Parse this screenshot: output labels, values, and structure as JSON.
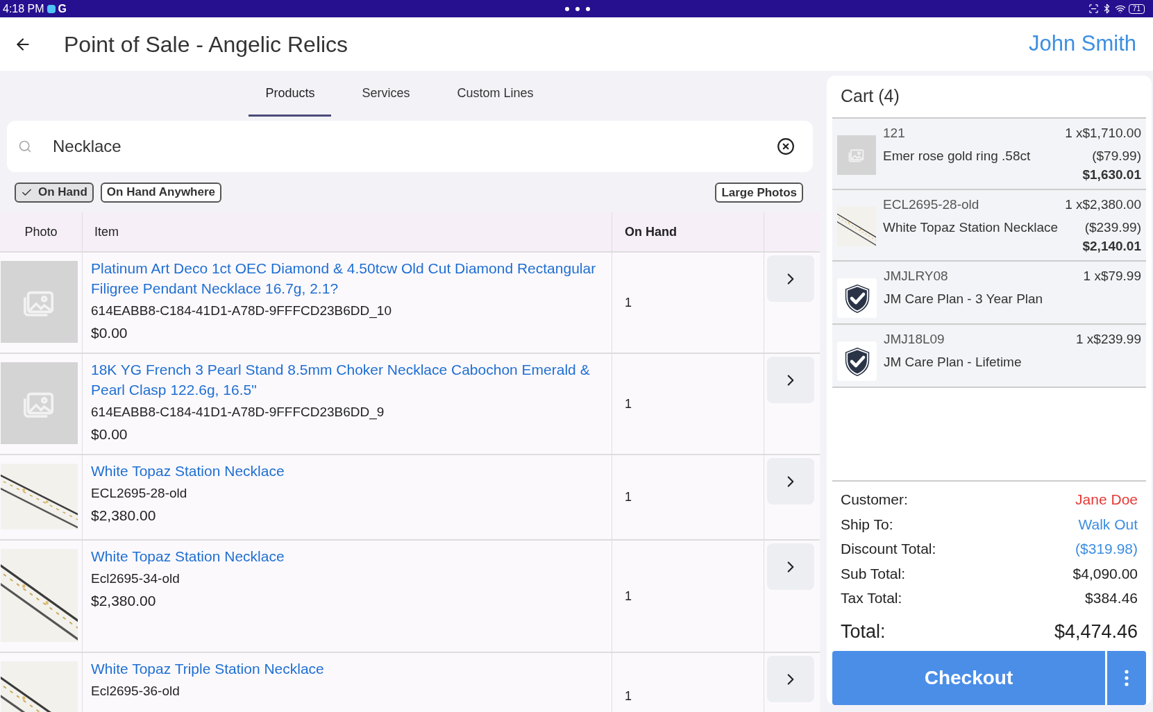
{
  "status_bar": {
    "time": "4:18 PM",
    "app_letter": "G",
    "battery": "71"
  },
  "header": {
    "title": "Point of Sale - Angelic Relics",
    "user": "John Smith"
  },
  "tabs": [
    {
      "label": "Products",
      "selected": true
    },
    {
      "label": "Services",
      "selected": false
    },
    {
      "label": "Custom Lines",
      "selected": false
    }
  ],
  "search": {
    "value": "Necklace"
  },
  "filters": [
    {
      "label": "On Hand",
      "checked": true
    },
    {
      "label": "On Hand Anywhere",
      "checked": false
    }
  ],
  "large_photos_button": "Large Photos",
  "table": {
    "columns": [
      "Photo",
      "Item",
      "On Hand"
    ],
    "rows": [
      {
        "kind": "placeholder",
        "name": "Platinum Art Deco 1ct OEC Diamond & 4.50tcw Old Cut Diamond Rectangular Filigree Pendant Necklace 16.7g, 2.1?",
        "sku": "614EABB8-C184-41D1-A78D-9FFFCD23B6DD_10",
        "price": "$0.00",
        "on_hand": "1"
      },
      {
        "kind": "placeholder",
        "name": "18K YG French 3 Pearl Stand 8.5mm Choker Necklace Cabochon Emerald & Pearl Clasp 122.6g, 16.5\"",
        "sku": "614EABB8-C184-41D1-A78D-9FFFCD23B6DD_9",
        "price": "$0.00",
        "on_hand": "1"
      },
      {
        "kind": "necklace",
        "name": "White Topaz Station Necklace",
        "sku": "ECL2695-28-old",
        "price": "$2,380.00",
        "on_hand": "1"
      },
      {
        "kind": "necklace",
        "name": "White Topaz Station Necklace",
        "sku": "Ecl2695-34-old",
        "price": "$2,380.00",
        "on_hand": "1"
      },
      {
        "kind": "necklace",
        "name": "White Topaz Triple Station Necklace",
        "sku": "Ecl2695-36-old",
        "on_hand": "1"
      }
    ]
  },
  "cart": {
    "title": "Cart (4)",
    "items": [
      {
        "kind": "placeholder",
        "code": "121",
        "name": "Emer rose gold ring .58ct",
        "qty_price": "1 x$1,710.00",
        "discount": "($79.99)",
        "total": "$1,630.01"
      },
      {
        "kind": "necklace",
        "code": "ECL2695-28-old",
        "name": "White Topaz Station Necklace",
        "qty_price": "1 x$2,380.00",
        "discount": "($239.99)",
        "total": "$2,140.01"
      },
      {
        "kind": "shield",
        "code": "JMJLRY08",
        "name": "JM Care Plan - 3 Year Plan",
        "qty_price": "1 x$79.99"
      },
      {
        "kind": "shield",
        "code": "JMJ18L09",
        "name": "JM Care Plan - Lifetime",
        "qty_price": "1 x$239.99"
      }
    ]
  },
  "summary": [
    {
      "label": "Customer:",
      "value": "Jane Doe",
      "kind": "customer"
    },
    {
      "label": "Ship To:",
      "value": "Walk Out",
      "kind": "link"
    },
    {
      "label": "Discount Total:",
      "value": "($319.98)",
      "kind": "link"
    },
    {
      "label": "Sub Total:",
      "value": "$4,090.00",
      "kind": "plain"
    },
    {
      "label": "Tax Total:",
      "value": "$384.46",
      "kind": "plain"
    },
    {
      "label": "Total:",
      "value": "$4,474.46",
      "kind": "total"
    }
  ],
  "checkout_button": "Checkout"
}
